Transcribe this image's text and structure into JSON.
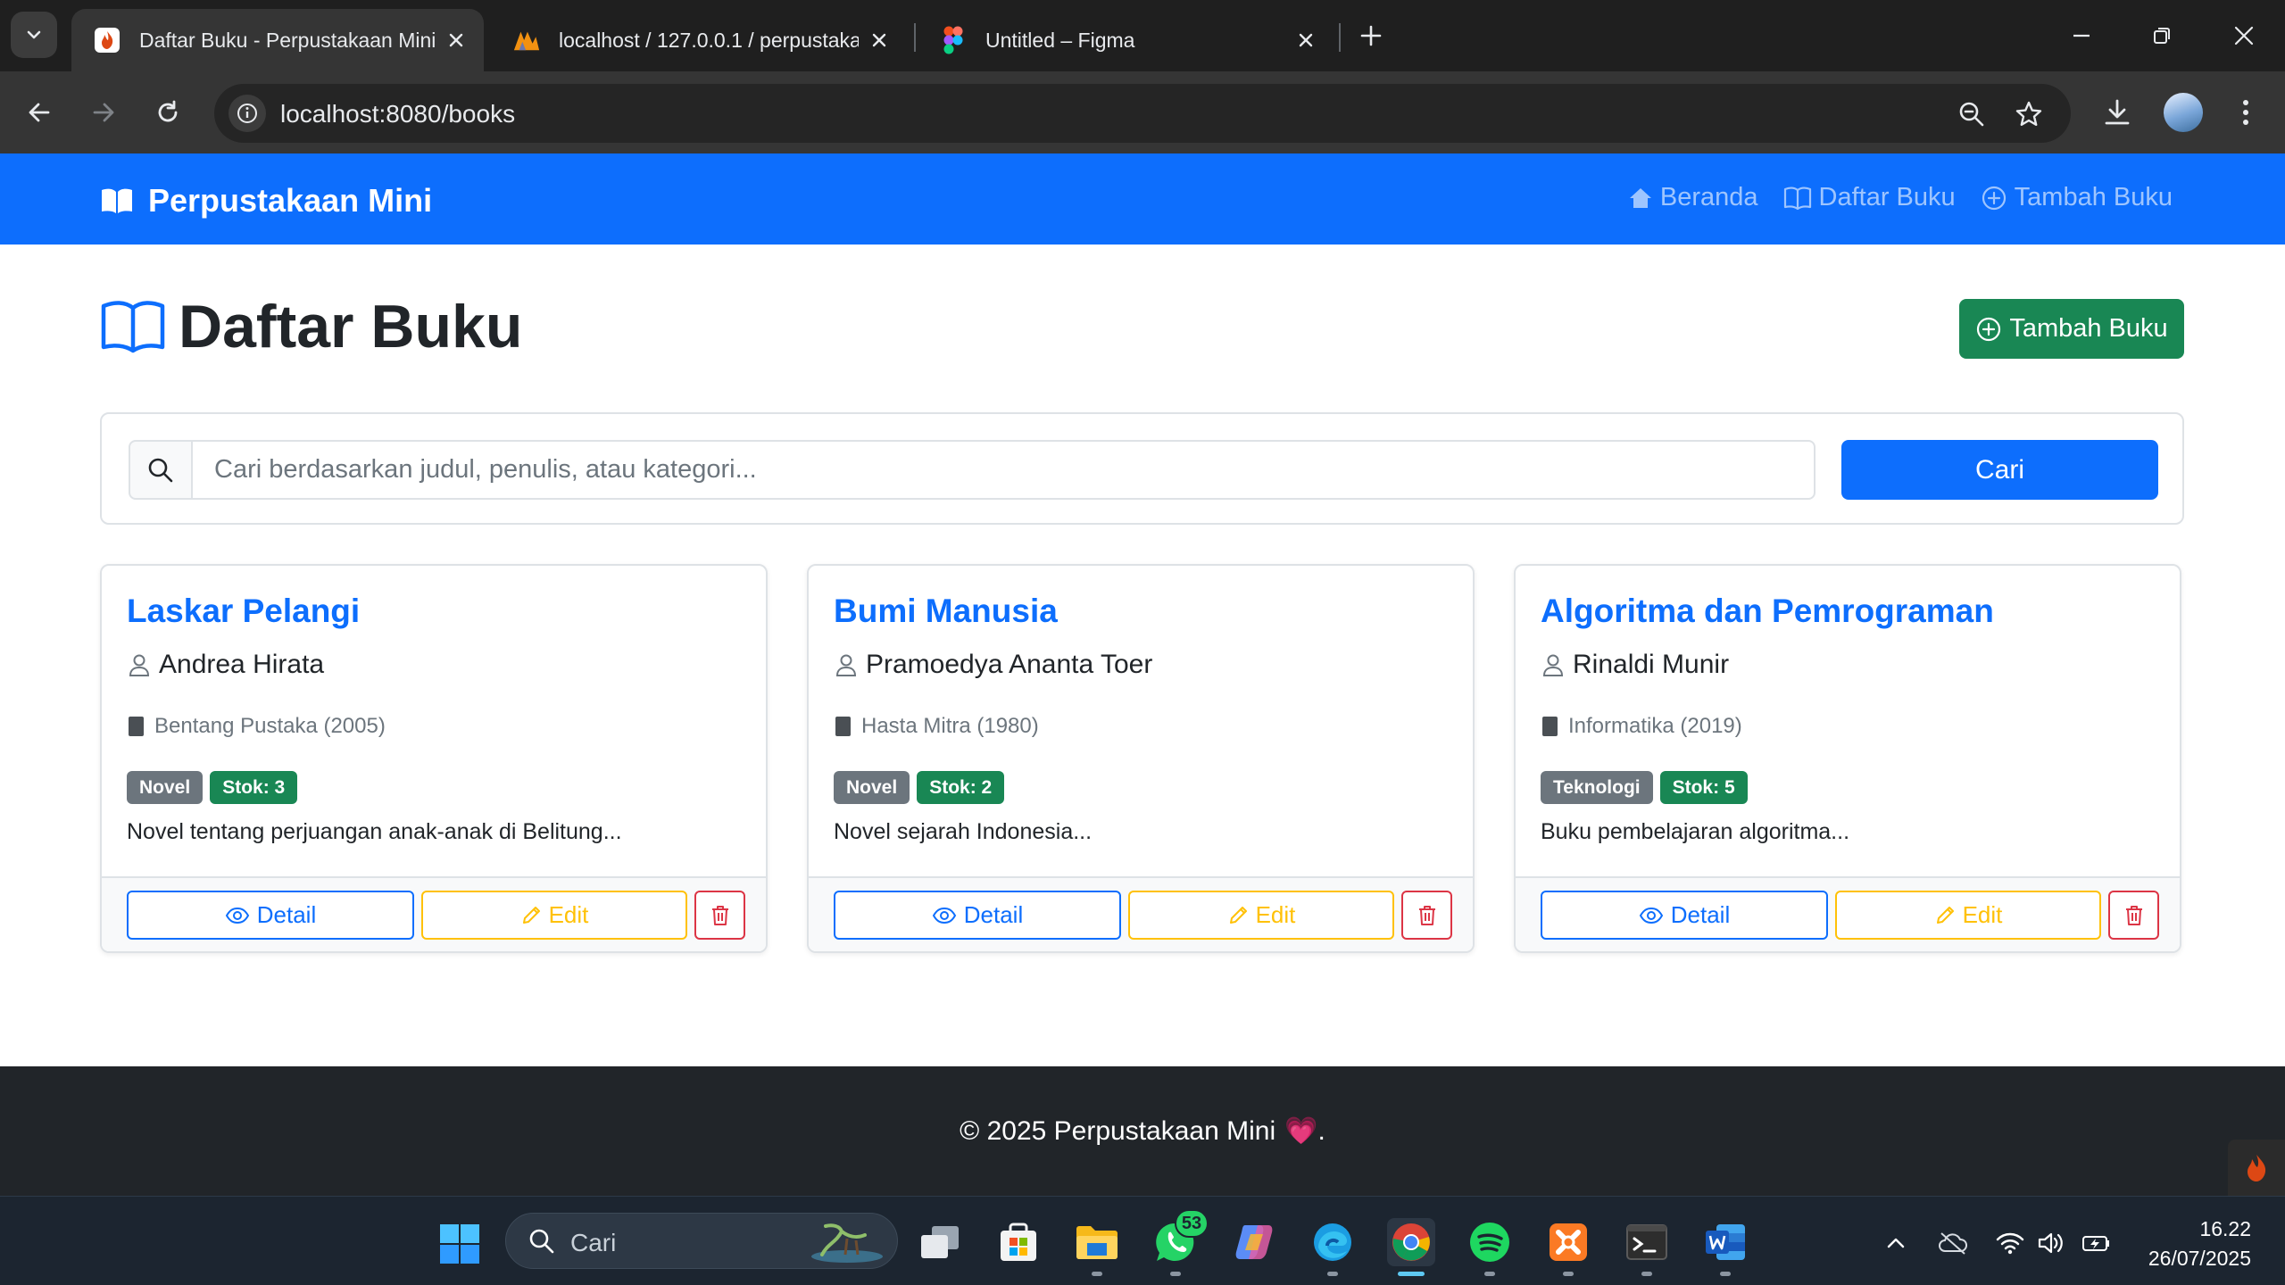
{
  "browser": {
    "tabs": [
      {
        "title": "Daftar Buku - Perpustakaan Mini",
        "active": true,
        "favicon": "codeigniter-flame-icon"
      },
      {
        "title": "localhost / 127.0.0.1 / perpustakaan",
        "active": false,
        "favicon": "phpmyadmin-icon"
      },
      {
        "title": "Untitled – Figma",
        "active": false,
        "favicon": "figma-icon"
      }
    ],
    "url": "localhost:8080/books"
  },
  "navbar": {
    "brand": "Perpustakaan Mini",
    "links": [
      {
        "label": "Beranda",
        "icon": "house-icon"
      },
      {
        "label": "Daftar Buku",
        "icon": "book-icon"
      },
      {
        "label": "Tambah Buku",
        "icon": "plus-circle-icon"
      }
    ]
  },
  "page": {
    "title": "Daftar Buku",
    "add_button": "Tambah Buku",
    "search": {
      "placeholder": "Cari berdasarkan judul, penulis, atau kategori...",
      "value": "",
      "button": "Cari"
    }
  },
  "books": [
    {
      "title": "Laskar Pelangi",
      "author": "Andrea Hirata",
      "publisher": "Bentang Pustaka (2005)",
      "category": "Novel",
      "stock": "Stok: 3",
      "description": "Novel tentang perjuangan anak-anak di Belitung...",
      "detail": "Detail",
      "edit": "Edit"
    },
    {
      "title": "Bumi Manusia",
      "author": "Pramoedya Ananta Toer",
      "publisher": "Hasta Mitra (1980)",
      "category": "Novel",
      "stock": "Stok: 2",
      "description": "Novel sejarah Indonesia...",
      "detail": "Detail",
      "edit": "Edit"
    },
    {
      "title": "Algoritma dan Pemrograman",
      "author": "Rinaldi Munir",
      "publisher": "Informatika (2019)",
      "category": "Teknologi",
      "stock": "Stok: 5",
      "description": "Buku pembelajaran algoritma...",
      "detail": "Detail",
      "edit": "Edit"
    }
  ],
  "footer": {
    "text": "© 2025 Perpustakaan Mini",
    "heart": "💗",
    "suffix": "."
  },
  "taskbar": {
    "search_label": "Cari",
    "whatsapp_badge": "53",
    "time": "16.22",
    "date": "26/07/2025"
  },
  "colors": {
    "primary": "#0d6efd",
    "success": "#198754",
    "warning": "#ffc107",
    "danger": "#dc3545",
    "secondary": "#6c757d",
    "dark": "#212529"
  }
}
